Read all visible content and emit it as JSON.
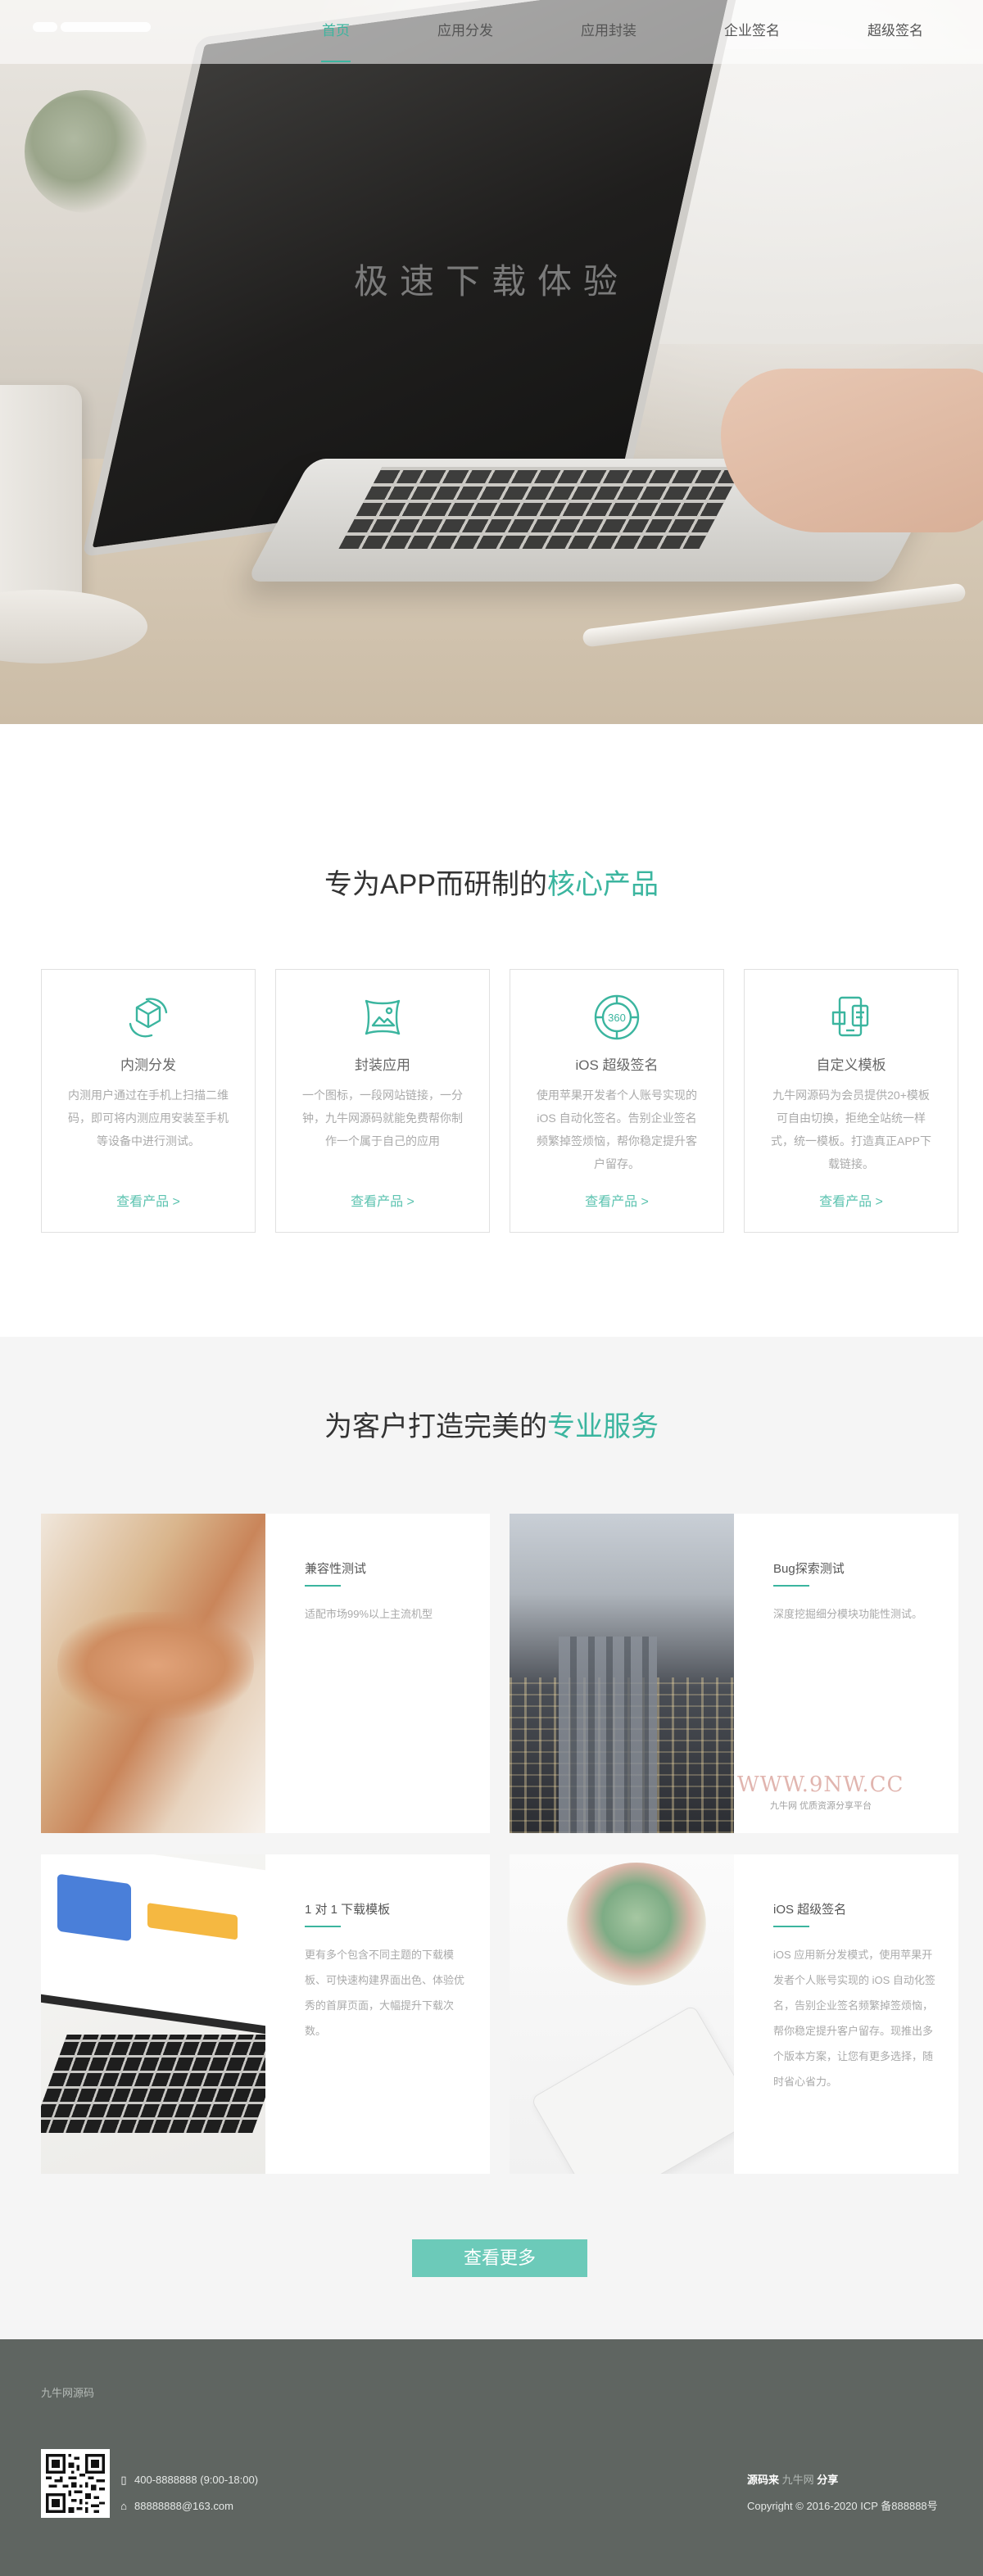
{
  "nav": {
    "items": [
      {
        "label": "首页",
        "active": true
      },
      {
        "label": "应用分发",
        "active": false
      },
      {
        "label": "应用封装",
        "active": false
      },
      {
        "label": "企业签名",
        "active": false
      },
      {
        "label": "超级签名",
        "active": false
      }
    ]
  },
  "hero": {
    "title": "极速下载体验"
  },
  "products": {
    "title_prefix": "专为APP而研制的",
    "title_highlight": "核心产品",
    "cards": [
      {
        "icon": "cube-icon",
        "name": "内测分发",
        "desc": "内测用户通过在手机上扫描二维码，即可将内测应用安装至手机等设备中进行测试。",
        "link": "查看产品 >"
      },
      {
        "icon": "picture-icon",
        "name": "封装应用",
        "desc": "一个图标，一段网站链接，一分钟，九牛网源码就能免费帮你制作一个属于自己的应用",
        "link": "查看产品 >"
      },
      {
        "icon": "360-icon",
        "name": "iOS 超级签名",
        "desc": "使用苹果开发者个人账号实现的 iOS 自动化签名。告别企业签名频繁掉签烦恼，帮你稳定提升客户留存。",
        "link": "查看产品 >"
      },
      {
        "icon": "template-icon",
        "name": "自定义模板",
        "desc": "九牛网源码为会员提供20+模板可自由切换，拒绝全站统一样式，统一模板。打造真正APP下载链接。",
        "link": "查看产品 >"
      }
    ]
  },
  "services": {
    "title_prefix": "为客户打造完美的",
    "title_highlight": "专业服务",
    "items": [
      {
        "title": "兼容性测试",
        "desc": "适配市场99%以上主流机型"
      },
      {
        "title": "Bug探索测试",
        "desc": "深度挖掘细分模块功能性测试。"
      },
      {
        "title": "1 对 1 下载模板",
        "desc": "更有多个包含不同主题的下载模板、可快速构建界面出色、体验优秀的首屏页面，大幅提升下载次数。"
      },
      {
        "title": "iOS 超级签名",
        "desc": "iOS 应用新分发模式，使用苹果开发者个人账号实现的 iOS 自动化签名，告别企业签名频繁掉签烦恼，帮你稳定提升客户留存。现推出多个版本方案，让您有更多选择，随时省心省力。"
      }
    ],
    "watermark_main": "WWW.9NW.CC",
    "watermark_sub": "九牛网 优质资源分享平台",
    "more_button": "查看更多"
  },
  "footer": {
    "brand": "九牛网源码",
    "phone": "400-8888888   (9:00-18:00)",
    "email": "88888888@163.com",
    "source_label": "源码来",
    "source_site": "九牛网",
    "source_suffix": "分享",
    "copyright": "Copyright © 2016-2020  ICP 备888888号"
  },
  "colors": {
    "accent": "#3bb59f",
    "button": "#6ccab9",
    "footer_bg": "#5f6561",
    "section_bg": "#f5f5f5"
  }
}
